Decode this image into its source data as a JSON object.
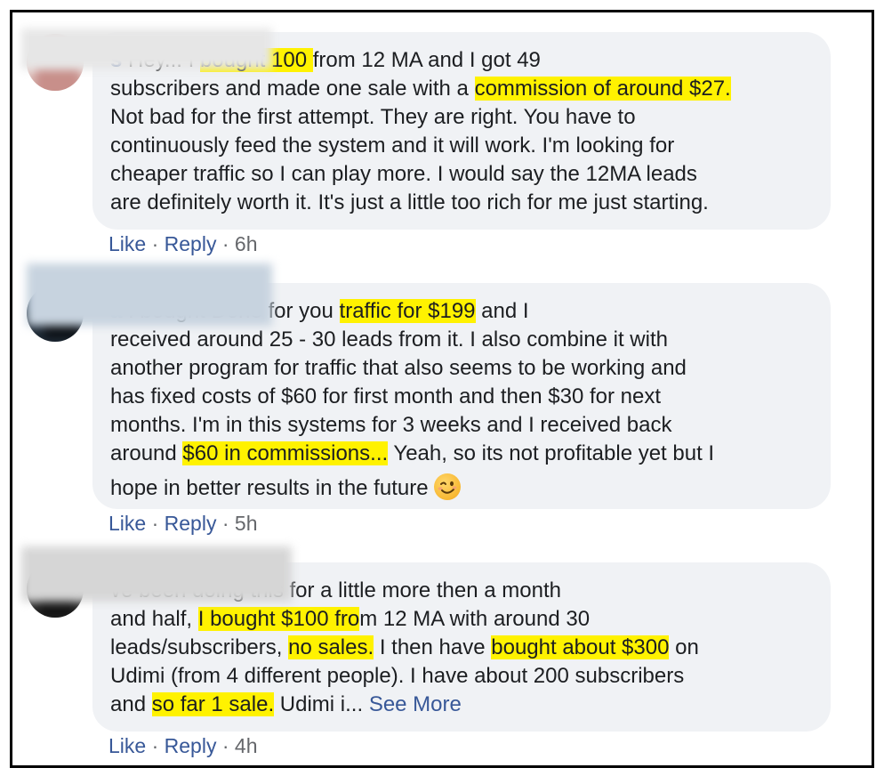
{
  "comments": [
    {
      "lines": [
        [
          {
            "t": "Hey... I "
          },
          {
            "t": "bought 100 ",
            "h": true
          },
          {
            "t": "from 12 MA and I got 49"
          }
        ],
        [
          {
            "t": "subscribers and made one sale with a "
          },
          {
            "t": "commission of around $27. ",
            "h": true
          }
        ],
        [
          {
            "t": "Not bad for the first attempt. They are right. You have to"
          }
        ],
        [
          {
            "t": "continuously feed the system and it will work. I'm looking for"
          }
        ],
        [
          {
            "t": "cheaper traffic so I can play more. I would say the 12MA leads"
          }
        ],
        [
          {
            "t": "are definitely worth it. It's just a little too rich for me just starting."
          }
        ]
      ],
      "name_fragment": "s",
      "like_label": "Like",
      "reply_label": "Reply",
      "time": "6h"
    },
    {
      "lines": [
        [
          {
            "t": "I bought Done for you "
          },
          {
            "t": "traffic for $199",
            "h": true
          },
          {
            "t": " and I"
          }
        ],
        [
          {
            "t": "received around 25 - 30 leads from it. I also combine it with"
          }
        ],
        [
          {
            "t": "another program for traffic that also seems to be working and"
          }
        ],
        [
          {
            "t": "has fixed costs of $60 for first month and then $30 for next"
          }
        ],
        [
          {
            "t": "months. I'm in this systems for 3 weeks and I received back"
          }
        ],
        [
          {
            "t": "around "
          },
          {
            "t": "$60 in commissions...",
            "h": true
          },
          {
            "t": " Yeah, so its not profitable yet but I"
          }
        ],
        [
          {
            "t": "hope in better results in the future"
          }
        ]
      ],
      "name_fragment": "a",
      "emoji": "winking-face",
      "like_label": "Like",
      "reply_label": "Reply",
      "time": "5h"
    },
    {
      "lines": [
        [
          {
            "t": "ve been doing this for a little more then a month"
          }
        ],
        [
          {
            "t": "and half, "
          },
          {
            "t": "I bought $100 fro",
            "h": true
          },
          {
            "t": "m 12 MA with around 30"
          }
        ],
        [
          {
            "t": "leads/subscribers, "
          },
          {
            "t": "no sales.",
            "h": true
          },
          {
            "t": " I then have "
          },
          {
            "t": "bought about $300",
            "h": true
          },
          {
            "t": " on"
          }
        ],
        [
          {
            "t": "Udimi (from 4 different people). I have about 200 subscribers"
          }
        ],
        [
          {
            "t": "and "
          },
          {
            "t": "so far 1 sale.",
            "h": true
          },
          {
            "t": " Udimi i... "
          }
        ]
      ],
      "see_more": "See More",
      "like_label": "Like",
      "reply_label": "Reply",
      "time": "4h"
    }
  ],
  "separator": " · ",
  "colors": {
    "highlight": "#fff200",
    "link": "#385898",
    "bubble": "#f0f2f5",
    "text": "#1c1e21",
    "meta": "#65676b"
  }
}
